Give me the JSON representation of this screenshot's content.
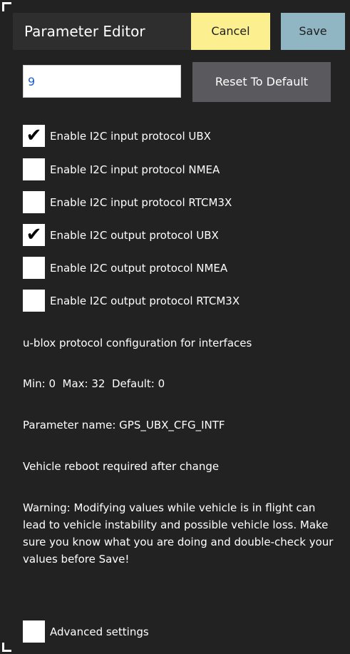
{
  "dialog": {
    "title": "Parameter Editor",
    "cancel_label": "Cancel",
    "save_label": "Save"
  },
  "value_field": {
    "value": "9",
    "reset_label": "Reset To Default"
  },
  "bitmask_options": [
    {
      "label": "Enable I2C input protocol UBX",
      "checked": true
    },
    {
      "label": "Enable I2C input protocol NMEA",
      "checked": false
    },
    {
      "label": "Enable I2C input protocol RTCM3X",
      "checked": false
    },
    {
      "label": "Enable I2C output protocol UBX",
      "checked": true
    },
    {
      "label": "Enable I2C output protocol NMEA",
      "checked": false
    },
    {
      "label": "Enable I2C output protocol RTCM3X",
      "checked": false
    }
  ],
  "info": {
    "description": "u-blox protocol configuration for interfaces",
    "range": "Min: 0  Max: 32  Default: 0",
    "param_name": "Parameter name: GPS_UBX_CFG_INTF",
    "reboot": "Vehicle reboot required after change",
    "warning": "Warning: Modifying values while vehicle is in flight can lead to vehicle instability and possible vehicle loss. Make sure you know what you are doing and double-check your values before Save!"
  },
  "advanced": {
    "label": "Advanced settings",
    "checked": false
  },
  "colors": {
    "background": "#222222",
    "cancel_button": "#fbef8f",
    "save_button": "#8fb6c2",
    "reset_button": "#5a5a5e"
  }
}
